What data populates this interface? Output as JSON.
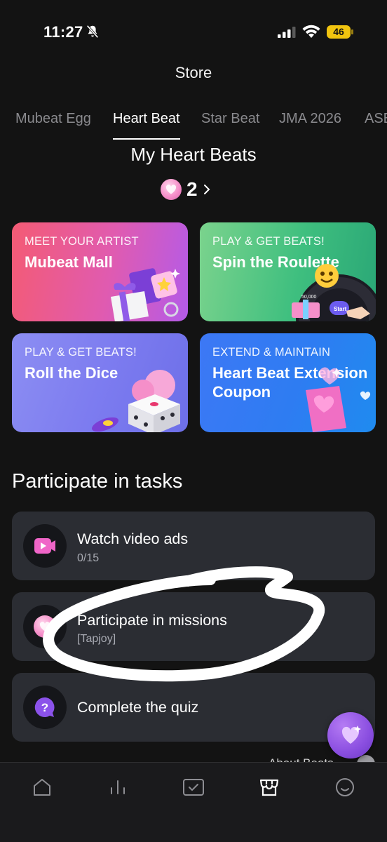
{
  "status_bar": {
    "time": "11:27",
    "battery": "46",
    "icons": [
      "bell-slash-icon",
      "signal-icon",
      "wifi-icon",
      "battery-icon"
    ]
  },
  "header": {
    "title": "Store"
  },
  "tabs": [
    {
      "label": "Mubeat Egg",
      "active": false
    },
    {
      "label": "Heart Beat",
      "active": true
    },
    {
      "label": "Star Beat",
      "active": false
    },
    {
      "label": "JMA 2026",
      "active": false
    },
    {
      "label": "ASE",
      "active": false
    }
  ],
  "my_beats": {
    "title": "My Heart Beats",
    "count": "2"
  },
  "cards": [
    {
      "kicker": "MEET YOUR ARTIST",
      "title": "Mubeat Mall"
    },
    {
      "kicker": "PLAY & GET BEATS!",
      "title": "Spin the Roulette",
      "art_labels": [
        "50,000",
        "Start"
      ]
    },
    {
      "kicker": "PLAY & GET BEATS!",
      "title": "Roll the Dice"
    },
    {
      "kicker": "EXTEND & MAINTAIN",
      "title": "Heart Beat Extension Coupon"
    }
  ],
  "tasks_section": {
    "title": "Participate in tasks",
    "items": [
      {
        "title": "Watch video ads",
        "subtitle": "0/15",
        "icon": "video-play-icon"
      },
      {
        "title": "Participate in missions",
        "subtitle": "[Tapjoy]",
        "icon": "heart-coin-icon"
      },
      {
        "title": "Complete the quiz",
        "subtitle": "",
        "icon": "question-bubble-icon"
      }
    ]
  },
  "peek_text": "About Beats",
  "fab": {
    "icon": "heart-sparkle-icon"
  },
  "bottom_nav": [
    "home-icon",
    "chart-icon",
    "check-square-icon",
    "store-icon",
    "profile-icon"
  ],
  "colors": {
    "background": "#131313",
    "task_card": "#2b2d33",
    "accent_pink": "#f58fc9",
    "accent_purple": "#8a4ee0"
  }
}
